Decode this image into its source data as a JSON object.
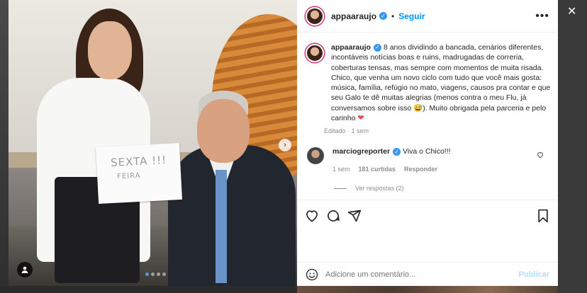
{
  "post": {
    "username": "appaaraujo",
    "follow_label": "Seguir",
    "more_label": "•••",
    "separator": "•",
    "sign_line1": "SEXTA !!!",
    "sign_line2": "FEIRA",
    "carousel": {
      "count": 4,
      "active_index": 0
    }
  },
  "caption": {
    "username": "appaaraujo",
    "text": "8 anos dividindo a bancada, cenários diferentes, incontáveis notícias boas e ruins, madrugadas de correria, coberturas tensas, mas sempre com momentos de muita risada. Chico, que venha um novo ciclo com tudo que você mais gosta: música, família, refúgio no mato, viagens, causos pra contar e que seu Galo te dê muitas alegrias (menos contra o meu Flu, já conversamos sobre isso 😅). Muito obrigada pela parceria e pelo carinho",
    "heart": "❤",
    "edited": "Editado · 1 sem"
  },
  "comment": {
    "username": "marciogreporter",
    "text": "Viva o Chico!!!",
    "time": "1 sem",
    "likes": "181 curtidas",
    "reply_label": "Responder",
    "view_replies": "Ver respostas (2)"
  },
  "composer": {
    "placeholder": "Adicione um comentário...",
    "publish_label": "Publicar"
  },
  "colors": {
    "accent": "#0095f6",
    "verified": "#3897f0",
    "heart": "#ed4956",
    "publish_disabled": "#b2dffc"
  },
  "icons": [
    "verified-badge-icon",
    "more-options-icon",
    "heart-icon",
    "comment-icon",
    "share-icon",
    "bookmark-icon",
    "emoji-icon",
    "tag-user-icon",
    "next-arrow-icon",
    "close-icon"
  ]
}
